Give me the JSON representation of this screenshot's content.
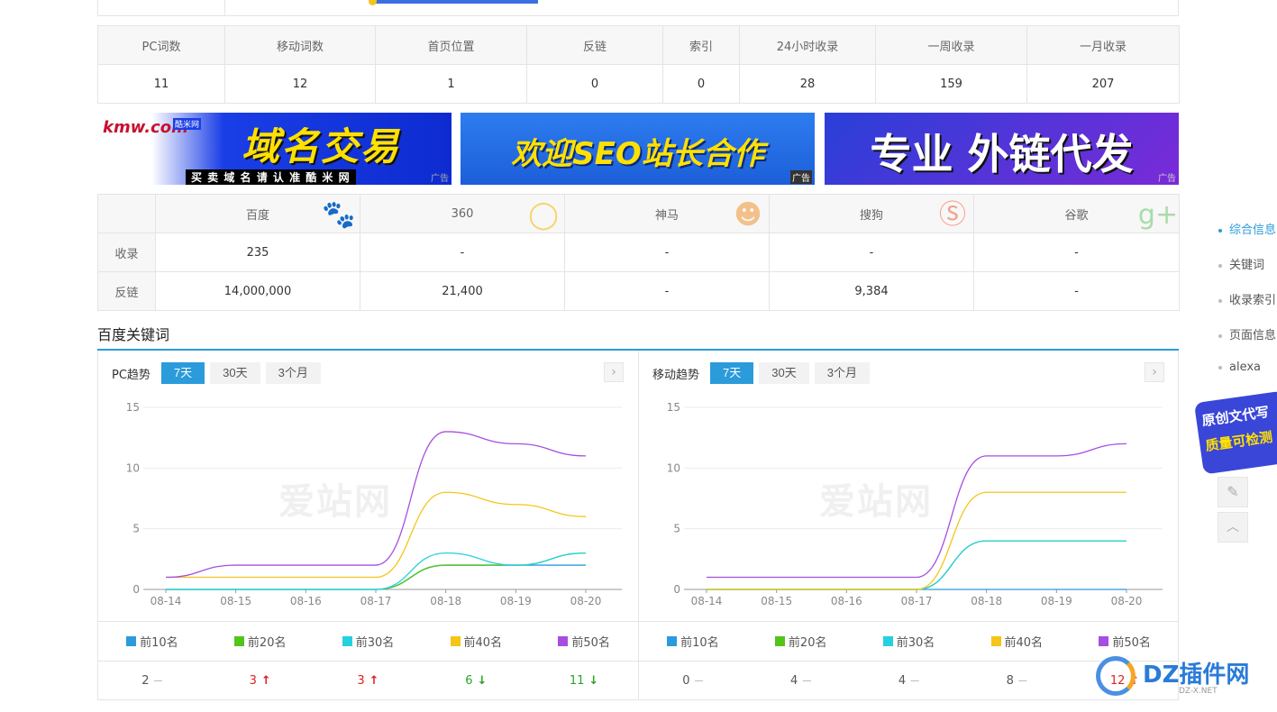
{
  "stats": {
    "headers": [
      "PC词数",
      "移动词数",
      "首页位置",
      "反链",
      "索引",
      "24小时收录",
      "一周收录",
      "一月收录"
    ],
    "values": [
      "11",
      "12",
      "1",
      "0",
      "0",
      "28",
      "159",
      "207"
    ]
  },
  "ads": [
    {
      "brand": "kmw.com",
      "brand_sub": "酷米网",
      "main": "域名交易",
      "sub": "买 卖 域 名 请 认 准 酷 米 网",
      "tag": "广告"
    },
    {
      "main": "欢迎SEO站长合作",
      "tag": "广告"
    },
    {
      "main": "专业 外链代发",
      "tag": "广告"
    }
  ],
  "engines": {
    "headers": [
      "百度",
      "360",
      "神马",
      "搜狗",
      "谷歌"
    ],
    "icons": [
      "paw-icon",
      "search-icon",
      "shenma-icon",
      "sogou-icon",
      "google-plus-icon"
    ],
    "rows": [
      {
        "label": "收录",
        "values": [
          "235",
          "-",
          "-",
          "-",
          "-"
        ]
      },
      {
        "label": "反链",
        "values": [
          "14,000,000",
          "21,400",
          "-",
          "9,384",
          "-"
        ]
      }
    ]
  },
  "section_title": "百度关键词",
  "watermark": "爱站网",
  "panels": [
    {
      "title": "PC趋势",
      "tabs": [
        "7天",
        "30天",
        "3个月"
      ],
      "active_tab": 0,
      "legend": [
        "前10名",
        "前20名",
        "前30名",
        "前40名",
        "前50名"
      ],
      "values": [
        {
          "v": "2",
          "trend": "flat"
        },
        {
          "v": "3",
          "trend": "up"
        },
        {
          "v": "3",
          "trend": "up"
        },
        {
          "v": "6",
          "trend": "down"
        },
        {
          "v": "11",
          "trend": "down"
        }
      ]
    },
    {
      "title": "移动趋势",
      "tabs": [
        "7天",
        "30天",
        "3个月"
      ],
      "active_tab": 0,
      "legend": [
        "前10名",
        "前20名",
        "前30名",
        "前40名",
        "前50名"
      ],
      "values": [
        {
          "v": "0",
          "trend": "flat"
        },
        {
          "v": "4",
          "trend": "flat"
        },
        {
          "v": "4",
          "trend": "flat"
        },
        {
          "v": "8",
          "trend": "flat"
        },
        {
          "v": "12",
          "trend": "up"
        }
      ]
    }
  ],
  "series_colors": [
    "#2b9bdb",
    "#52c41a",
    "#25d0e0",
    "#f5c518",
    "#a64ee0"
  ],
  "chart_data": [
    {
      "type": "line",
      "x": [
        "08-14",
        "08-15",
        "08-16",
        "08-17",
        "08-18",
        "08-19",
        "08-20"
      ],
      "ylim": [
        0,
        15
      ],
      "yticks": [
        0,
        5,
        10,
        15
      ],
      "series": [
        {
          "name": "前10名",
          "values": [
            0,
            0,
            0,
            0,
            2,
            2,
            2
          ]
        },
        {
          "name": "前20名",
          "values": [
            0,
            0,
            0,
            0,
            2,
            2,
            3
          ]
        },
        {
          "name": "前30名",
          "values": [
            0,
            0,
            0,
            0,
            3,
            2,
            3
          ]
        },
        {
          "name": "前40名",
          "values": [
            1,
            1,
            1,
            1,
            8,
            7,
            6
          ]
        },
        {
          "name": "前50名",
          "values": [
            1,
            2,
            2,
            2,
            13,
            12,
            11
          ]
        }
      ]
    },
    {
      "type": "line",
      "x": [
        "08-14",
        "08-15",
        "08-16",
        "08-17",
        "08-18",
        "08-19",
        "08-20"
      ],
      "ylim": [
        0,
        15
      ],
      "yticks": [
        0,
        5,
        10,
        15
      ],
      "series": [
        {
          "name": "前10名",
          "values": [
            0,
            0,
            0,
            0,
            0,
            0,
            0
          ]
        },
        {
          "name": "前20名",
          "values": [
            0,
            0,
            0,
            0,
            4,
            4,
            4
          ]
        },
        {
          "name": "前30名",
          "values": [
            0,
            0,
            0,
            0,
            4,
            4,
            4
          ]
        },
        {
          "name": "前40名",
          "values": [
            0,
            0,
            0,
            0,
            8,
            8,
            8
          ]
        },
        {
          "name": "前50名",
          "values": [
            1,
            1,
            1,
            1,
            11,
            11,
            12
          ]
        }
      ]
    }
  ],
  "sidebar": {
    "items": [
      "综合信息",
      "关键词",
      "收录索引",
      "页面信息",
      "alexa"
    ],
    "active": 0
  },
  "promo": {
    "line1": "原创文代写",
    "line2": "质量可检测"
  },
  "footer_logo": {
    "main": "DZ插件网",
    "sub": "DZ-X.NET"
  }
}
